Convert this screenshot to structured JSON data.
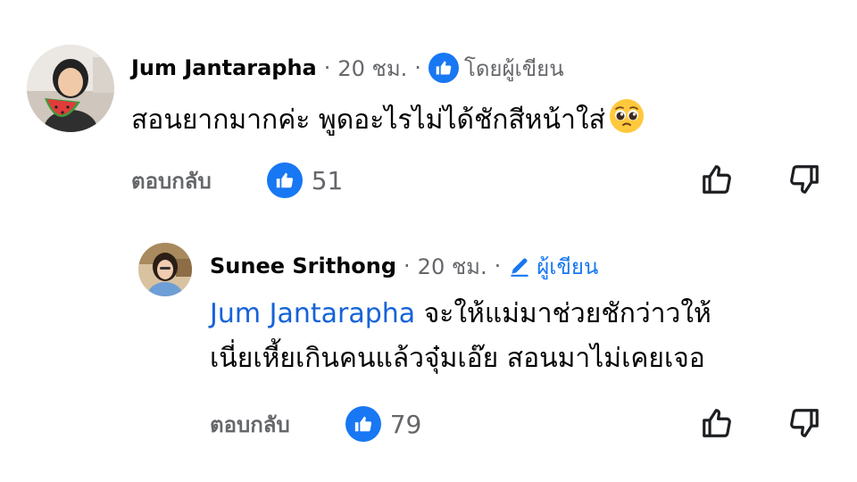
{
  "comments": [
    {
      "author": "Jum Jantarapha",
      "separator": "·",
      "time": "20 ชม.",
      "author_tag": "โดยผู้เขียน",
      "author_tag_icon": "thumbs-up-icon",
      "text": "สอนยากมากค่ะ พูดอะไรไม่ได้ชักสีหน้าใส่",
      "emoji": "pleading-face",
      "reply_label": "ตอบกลับ",
      "reaction_icon": "thumbs-up-icon",
      "reaction_count": "51"
    },
    {
      "author": "Sunee Srithong",
      "separator": "·",
      "time": "20 ชม.",
      "author_tag": "ผู้เขียน",
      "author_tag_icon": "pencil-icon",
      "mention": "Jum Jantarapha",
      "text_line1": " จะให้แม่มาช่วยชักว่าวให้",
      "text_line2": "เนี่ยเหี้ยเกินคนแล้วจุ๋มเอ๊ย สอนมาไม่เคยเจอ",
      "reply_label": "ตอบกลับ",
      "reaction_icon": "thumbs-up-icon",
      "reaction_count": "79"
    }
  ],
  "colors": {
    "text": "#050505",
    "meta": "#65676b",
    "accent": "#1877f2",
    "mention": "#1563d8"
  }
}
